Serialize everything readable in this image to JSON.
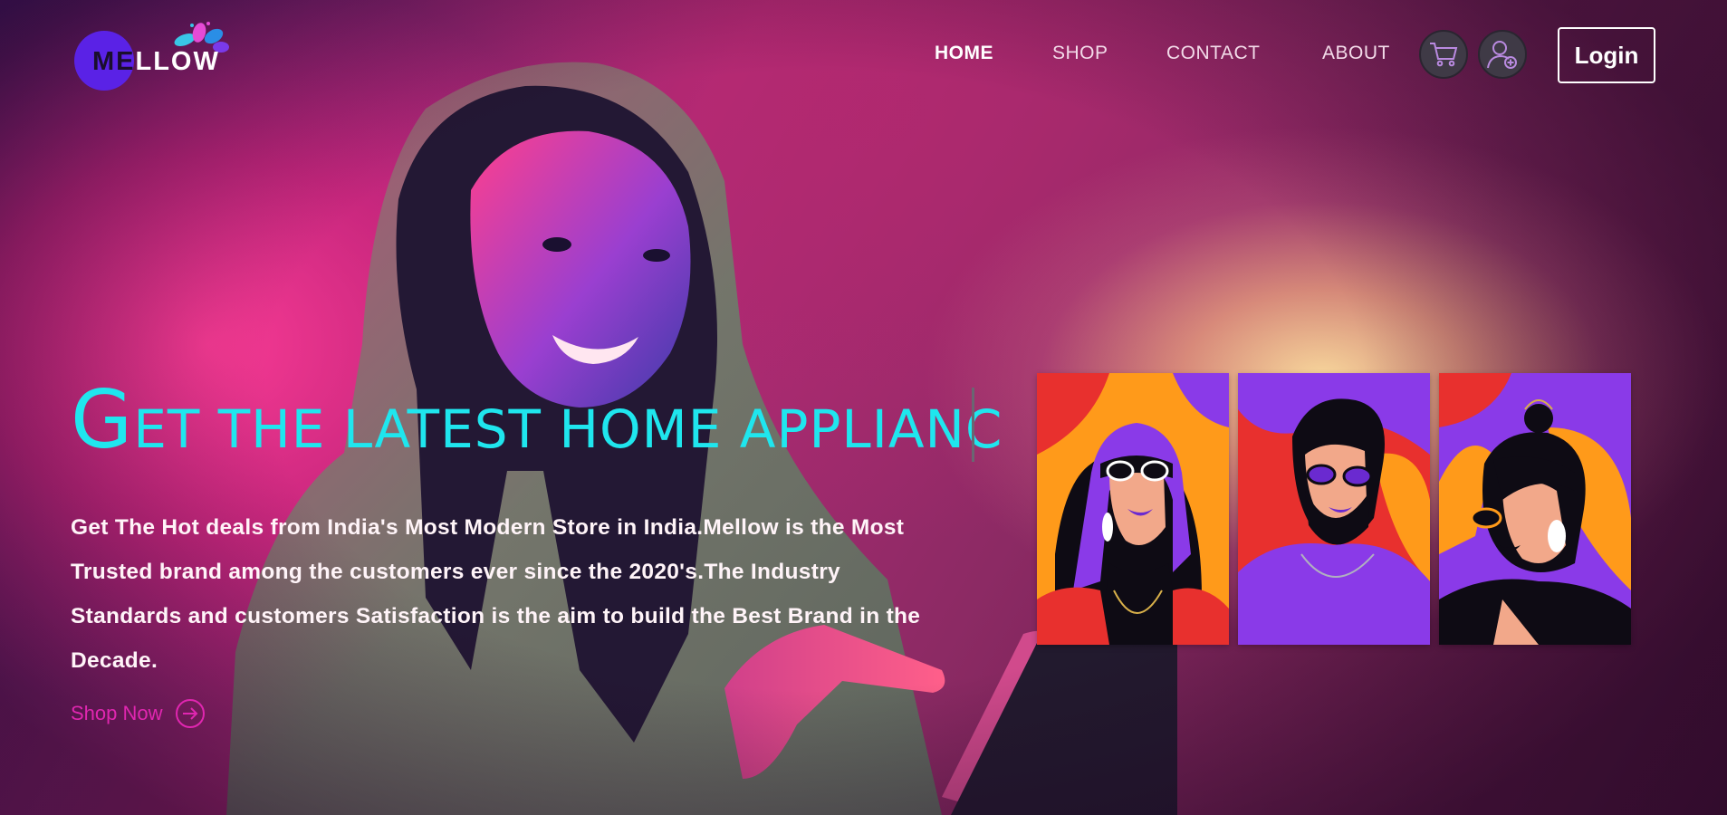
{
  "brand": {
    "logo_text_dark": "ME",
    "logo_text_light": "LLOW"
  },
  "nav": {
    "items": [
      {
        "label": "HOME",
        "active": true
      },
      {
        "label": "SHOP",
        "active": false
      },
      {
        "label": "CONTACT",
        "active": false
      },
      {
        "label": "ABOUT",
        "active": false
      }
    ],
    "cart_icon": "shopping-cart-icon",
    "user_icon": "add-user-icon",
    "login_label": "Login"
  },
  "hero": {
    "headline_first": "G",
    "headline_rest": "ET THE LATEST HOME APPLIANC",
    "description": "Get The Hot deals from India's Most Modern Store in India.Mellow is the Most Trusted brand among the customers ever since the 2020's.The Industry Standards and customers Satisfaction is the aim to build the Best Brand in the Decade.",
    "cta_label": "Shop Now",
    "cta_icon": "arrow-right-circle-icon"
  },
  "colors": {
    "headline": "#1fe6ee",
    "cta": "#e026b0",
    "logo_circle": "#5a22e6"
  }
}
